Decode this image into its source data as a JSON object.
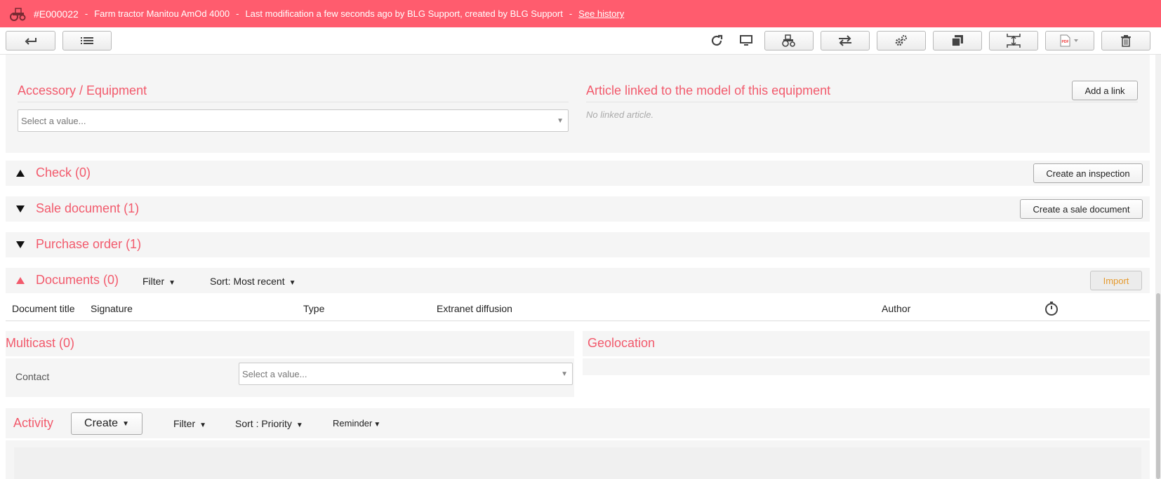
{
  "banner": {
    "code": "#E000022",
    "sep": "-",
    "name": "Farm tractor Manitou AmOd 4000",
    "modification": "Last modification a few seconds ago by BLG Support, created by BLG Support",
    "history_link": "See history",
    "background": "#ff5c6e"
  },
  "toolbar": {
    "icons": [
      "back-arrow-icon",
      "list-icon",
      "refresh-icon",
      "monitor-icon",
      "tractor-settings-icon",
      "transfer-arrows-icon",
      "settings-gears-icon",
      "copy-pages-icon",
      "split-icon",
      "pdf-icon",
      "trash-icon"
    ]
  },
  "accessory": {
    "title": "Accessory / Equipment",
    "placeholder": "Select a value..."
  },
  "article": {
    "title": "Article linked to the model of this equipment",
    "add_link": "Add a link",
    "empty": "No linked article."
  },
  "check": {
    "title": "Check (0)",
    "button": "Create an inspection"
  },
  "sale": {
    "title": "Sale document (1)",
    "button": "Create a sale document"
  },
  "purchase": {
    "title": "Purchase order (1)"
  },
  "documents": {
    "title": "Documents (0)",
    "filter": "Filter",
    "sort": "Sort: Most recent",
    "import": "Import",
    "columns": [
      "Document title",
      "Signature",
      "Type",
      "Extranet diffusion",
      "Author"
    ]
  },
  "multicast": {
    "title": "Multicast (0)",
    "contact_label": "Contact",
    "placeholder": "Select a value..."
  },
  "geolocation": {
    "title": "Geolocation"
  },
  "activity": {
    "title": "Activity",
    "create": "Create",
    "filter": "Filter",
    "sort": "Sort : Priority",
    "reminder": "Reminder"
  },
  "colors": {
    "accent": "#f25a6c",
    "import": "#e59a2e",
    "panel": "#f5f5f5"
  }
}
